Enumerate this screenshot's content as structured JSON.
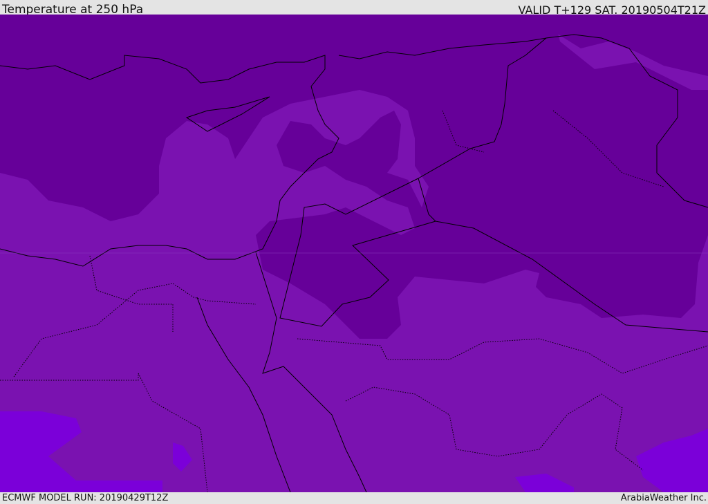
{
  "header": {
    "title": "Temperature at 250 hPa",
    "valid": "VALID T+129 SAT. 20190504T21Z"
  },
  "footer": {
    "model_run": "ECMWF MODEL RUN: 20190429T12Z",
    "credit": "ArabiaWeather Inc."
  },
  "colors": {
    "cold_band": "#660099",
    "mid_band": "#7a12b0",
    "warm_band": "#7b00d9",
    "border": "#000000",
    "background": "#e4e4e4"
  }
}
